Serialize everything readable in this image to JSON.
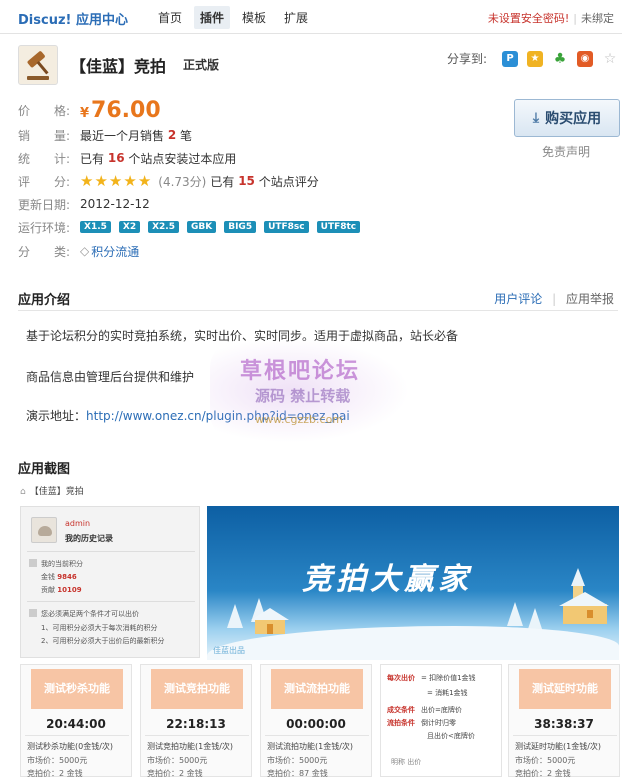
{
  "topbar": {
    "brand": "Discuz! 应用中心",
    "nav": [
      {
        "label": "首页",
        "active": false
      },
      {
        "label": "插件",
        "active": true
      },
      {
        "label": "模板",
        "active": false
      },
      {
        "label": "扩展",
        "active": false
      }
    ],
    "warning": "未设置安全密码!",
    "separator": "|",
    "unbound": "未绑定"
  },
  "header": {
    "icon": "auction-gavel-icon",
    "title": "【佳蓝】竞拍",
    "edition": "正式版",
    "share_label": "分享到:",
    "share_icons": [
      "qzone-icon",
      "star-bookmark-icon",
      "clover-icon",
      "rss-icon",
      "star-icon"
    ]
  },
  "info": {
    "price_label": [
      "价",
      "格:"
    ],
    "currency": "¥",
    "price": "76.00",
    "sales_label": [
      "销",
      "量:"
    ],
    "sales_prefix": "最近一个月销售",
    "sales_count": "2",
    "sales_suffix": "笔",
    "stats_label": [
      "统",
      "计:"
    ],
    "stats_prefix": "已有",
    "stats_count": "16",
    "stats_suffix": "个站点安装过本应用",
    "rating_label": [
      "评",
      "分:"
    ],
    "rating_stars": 5,
    "rating_score": "(4.73分)",
    "rating_prefix": "已有",
    "rating_count": "15",
    "rating_suffix": "个站点评分",
    "updated_label": "更新日期:",
    "updated": "2012-12-12",
    "env_label": "运行环境:",
    "env_tags": [
      "X1.5",
      "X2",
      "X2.5",
      "GBK",
      "BIG5",
      "UTF8sc",
      "UTF8tc"
    ],
    "category_label": [
      "分",
      "类:"
    ],
    "category": "积分流通",
    "buy_button": "购买应用",
    "disclaimer": "免责声明"
  },
  "intro": {
    "title": "应用介绍",
    "user_reviews": "用户评论",
    "separator": "|",
    "report": "应用举报",
    "p1": "基于论坛积分的实时竞拍系统，实时出价、实时同步。适用于虚拟商品，站长必备",
    "p2": "商品信息由管理后台提供和维护",
    "p3_label": "演示地址：",
    "p3_url": "http://www.onez.cn/plugin.php?id=onez_pai"
  },
  "watermark": {
    "line1": "草根吧论坛",
    "line2": "源码  禁止转载",
    "line3": "www.cgzzb.com"
  },
  "screenshot": {
    "title": "应用截图",
    "breadcrumb": "【佳蓝】竞拍",
    "user": "admin",
    "history": "我的历史记录",
    "points_title": "我的当前积分",
    "money_label": "金钱",
    "money": "9846",
    "contrib_label": "贡献",
    "contrib": "10109",
    "cond_title": "您必须满足两个条件才可以出价",
    "cond1": "1、可用积分必须大于每次消耗的积分",
    "cond2": "2、可用积分必须大于出价后的最新积分",
    "banner_title": "竞拍大赢家",
    "banner_caption": "佳蓝出品",
    "cards": [
      {
        "tag": "测试秒杀功能",
        "time": "20:44:00",
        "name": "测试秒杀功能(0金钱/次)",
        "price": "市场价：5000元",
        "bid": "竞拍价：2  金钱"
      },
      {
        "tag": "测试竞拍功能",
        "time": "22:18:13",
        "name": "测试竞拍功能(1金钱/次)",
        "price": "市场价：5000元",
        "bid": "竞拍价：2  金钱"
      },
      {
        "tag": "测试流拍功能",
        "time": "00:00:00",
        "name": "测试流拍功能(1金钱/次)",
        "price": "市场价：5000元",
        "bid": "竞拍价：87  金钱"
      },
      {
        "tag": "测试延时功能",
        "time": "38:38:37",
        "name": "测试延时功能(1金钱/次)",
        "price": "市场价：5000元",
        "bid": "竞拍价：2  金钱"
      }
    ],
    "rules": [
      {
        "k": "每次出价",
        "v": "= 扣除价值1金钱"
      },
      {
        "k": "",
        "v": "= 消耗1金钱"
      },
      {
        "k": "成交条件",
        "v": "出价=底牌价"
      },
      {
        "k": "流拍条件",
        "v": "倒计时归零"
      },
      {
        "k": "",
        "v": "且出价<底牌价"
      },
      {
        "k": "",
        "v": "明称          出价"
      }
    ]
  }
}
